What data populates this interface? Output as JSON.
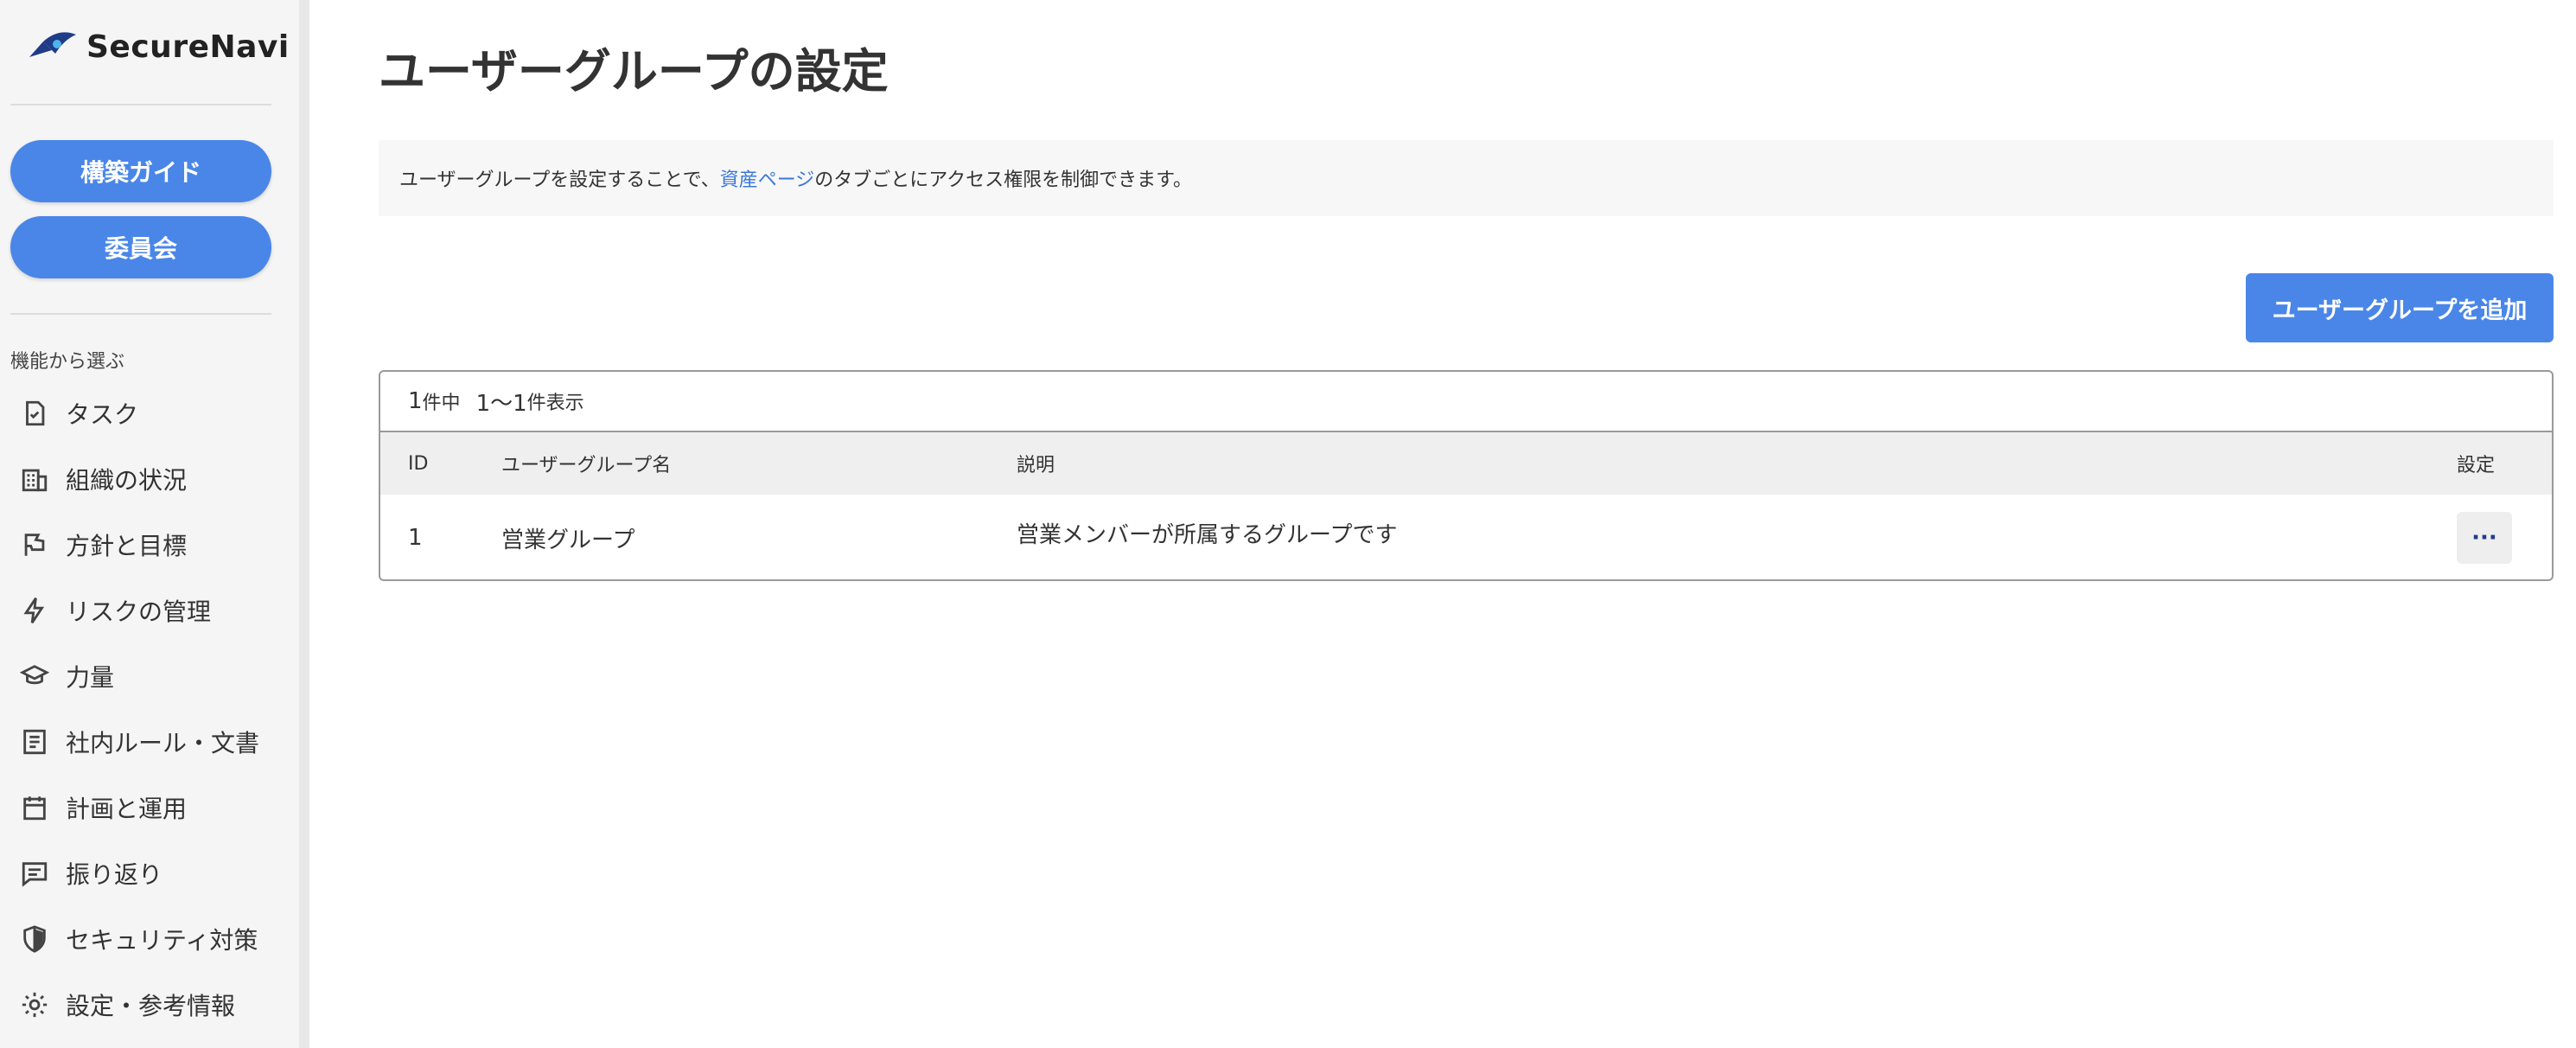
{
  "brand": {
    "name": "SecureNavi"
  },
  "sidebar": {
    "buttons": [
      {
        "label": "構築ガイド"
      },
      {
        "label": "委員会"
      }
    ],
    "section_label": "機能から選ぶ",
    "items": [
      {
        "label": "タスク",
        "icon": "task-check-icon"
      },
      {
        "label": "組織の状況",
        "icon": "building-icon"
      },
      {
        "label": "方針と目標",
        "icon": "flag-icon"
      },
      {
        "label": "リスクの管理",
        "icon": "lightning-icon"
      },
      {
        "label": "力量",
        "icon": "graduation-cap-icon"
      },
      {
        "label": "社内ルール・文書",
        "icon": "document-icon"
      },
      {
        "label": "計画と運用",
        "icon": "calendar-icon"
      },
      {
        "label": "振り返り",
        "icon": "comment-icon"
      },
      {
        "label": "セキュリティ対策",
        "icon": "shield-icon"
      },
      {
        "label": "設定・参考情報",
        "icon": "gear-icon"
      }
    ]
  },
  "main": {
    "title": "ユーザーグループの設定",
    "info": {
      "prefix": "ユーザーグループを設定することで、",
      "link": "資産ページ",
      "suffix": "のタブごとにアクセス権限を制御できます。"
    },
    "add_button": "ユーザーグループを追加",
    "table": {
      "count_total": "1",
      "count_total_suffix": "件中",
      "count_range": "1〜1",
      "count_range_suffix": "件表示",
      "headers": {
        "id": "ID",
        "name": "ユーザーグループ名",
        "description": "説明",
        "settings": "設定"
      },
      "rows": [
        {
          "id": "1",
          "name": "営業グループ",
          "description": "営業メンバーが所属するグループです",
          "action": "···"
        }
      ]
    }
  },
  "colors": {
    "accent": "#4a86e8",
    "link": "#3a78d8",
    "sidebar_bg": "#f5f5f5"
  }
}
